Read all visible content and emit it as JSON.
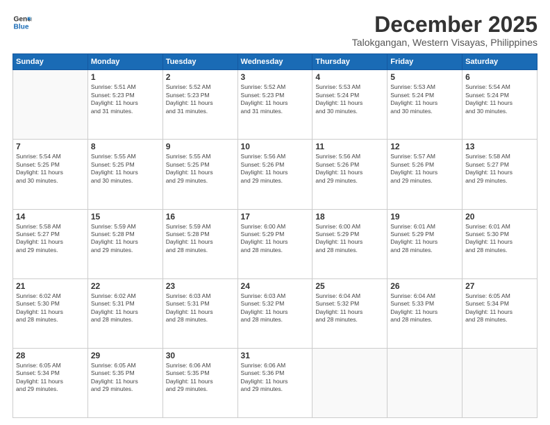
{
  "header": {
    "logo_line1": "General",
    "logo_line2": "Blue",
    "month_year": "December 2025",
    "location": "Talokgangan, Western Visayas, Philippines"
  },
  "weekdays": [
    "Sunday",
    "Monday",
    "Tuesday",
    "Wednesday",
    "Thursday",
    "Friday",
    "Saturday"
  ],
  "weeks": [
    [
      {
        "day": "",
        "info": ""
      },
      {
        "day": "1",
        "info": "Sunrise: 5:51 AM\nSunset: 5:23 PM\nDaylight: 11 hours\nand 31 minutes."
      },
      {
        "day": "2",
        "info": "Sunrise: 5:52 AM\nSunset: 5:23 PM\nDaylight: 11 hours\nand 31 minutes."
      },
      {
        "day": "3",
        "info": "Sunrise: 5:52 AM\nSunset: 5:23 PM\nDaylight: 11 hours\nand 31 minutes."
      },
      {
        "day": "4",
        "info": "Sunrise: 5:53 AM\nSunset: 5:24 PM\nDaylight: 11 hours\nand 30 minutes."
      },
      {
        "day": "5",
        "info": "Sunrise: 5:53 AM\nSunset: 5:24 PM\nDaylight: 11 hours\nand 30 minutes."
      },
      {
        "day": "6",
        "info": "Sunrise: 5:54 AM\nSunset: 5:24 PM\nDaylight: 11 hours\nand 30 minutes."
      }
    ],
    [
      {
        "day": "7",
        "info": "Sunrise: 5:54 AM\nSunset: 5:25 PM\nDaylight: 11 hours\nand 30 minutes."
      },
      {
        "day": "8",
        "info": "Sunrise: 5:55 AM\nSunset: 5:25 PM\nDaylight: 11 hours\nand 30 minutes."
      },
      {
        "day": "9",
        "info": "Sunrise: 5:55 AM\nSunset: 5:25 PM\nDaylight: 11 hours\nand 29 minutes."
      },
      {
        "day": "10",
        "info": "Sunrise: 5:56 AM\nSunset: 5:26 PM\nDaylight: 11 hours\nand 29 minutes."
      },
      {
        "day": "11",
        "info": "Sunrise: 5:56 AM\nSunset: 5:26 PM\nDaylight: 11 hours\nand 29 minutes."
      },
      {
        "day": "12",
        "info": "Sunrise: 5:57 AM\nSunset: 5:26 PM\nDaylight: 11 hours\nand 29 minutes."
      },
      {
        "day": "13",
        "info": "Sunrise: 5:58 AM\nSunset: 5:27 PM\nDaylight: 11 hours\nand 29 minutes."
      }
    ],
    [
      {
        "day": "14",
        "info": "Sunrise: 5:58 AM\nSunset: 5:27 PM\nDaylight: 11 hours\nand 29 minutes."
      },
      {
        "day": "15",
        "info": "Sunrise: 5:59 AM\nSunset: 5:28 PM\nDaylight: 11 hours\nand 29 minutes."
      },
      {
        "day": "16",
        "info": "Sunrise: 5:59 AM\nSunset: 5:28 PM\nDaylight: 11 hours\nand 28 minutes."
      },
      {
        "day": "17",
        "info": "Sunrise: 6:00 AM\nSunset: 5:29 PM\nDaylight: 11 hours\nand 28 minutes."
      },
      {
        "day": "18",
        "info": "Sunrise: 6:00 AM\nSunset: 5:29 PM\nDaylight: 11 hours\nand 28 minutes."
      },
      {
        "day": "19",
        "info": "Sunrise: 6:01 AM\nSunset: 5:29 PM\nDaylight: 11 hours\nand 28 minutes."
      },
      {
        "day": "20",
        "info": "Sunrise: 6:01 AM\nSunset: 5:30 PM\nDaylight: 11 hours\nand 28 minutes."
      }
    ],
    [
      {
        "day": "21",
        "info": "Sunrise: 6:02 AM\nSunset: 5:30 PM\nDaylight: 11 hours\nand 28 minutes."
      },
      {
        "day": "22",
        "info": "Sunrise: 6:02 AM\nSunset: 5:31 PM\nDaylight: 11 hours\nand 28 minutes."
      },
      {
        "day": "23",
        "info": "Sunrise: 6:03 AM\nSunset: 5:31 PM\nDaylight: 11 hours\nand 28 minutes."
      },
      {
        "day": "24",
        "info": "Sunrise: 6:03 AM\nSunset: 5:32 PM\nDaylight: 11 hours\nand 28 minutes."
      },
      {
        "day": "25",
        "info": "Sunrise: 6:04 AM\nSunset: 5:32 PM\nDaylight: 11 hours\nand 28 minutes."
      },
      {
        "day": "26",
        "info": "Sunrise: 6:04 AM\nSunset: 5:33 PM\nDaylight: 11 hours\nand 28 minutes."
      },
      {
        "day": "27",
        "info": "Sunrise: 6:05 AM\nSunset: 5:34 PM\nDaylight: 11 hours\nand 28 minutes."
      }
    ],
    [
      {
        "day": "28",
        "info": "Sunrise: 6:05 AM\nSunset: 5:34 PM\nDaylight: 11 hours\nand 29 minutes."
      },
      {
        "day": "29",
        "info": "Sunrise: 6:05 AM\nSunset: 5:35 PM\nDaylight: 11 hours\nand 29 minutes."
      },
      {
        "day": "30",
        "info": "Sunrise: 6:06 AM\nSunset: 5:35 PM\nDaylight: 11 hours\nand 29 minutes."
      },
      {
        "day": "31",
        "info": "Sunrise: 6:06 AM\nSunset: 5:36 PM\nDaylight: 11 hours\nand 29 minutes."
      },
      {
        "day": "",
        "info": ""
      },
      {
        "day": "",
        "info": ""
      },
      {
        "day": "",
        "info": ""
      }
    ]
  ]
}
